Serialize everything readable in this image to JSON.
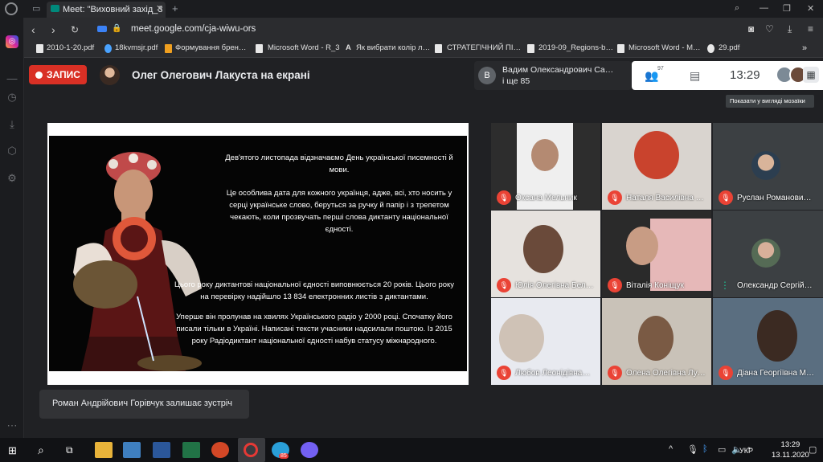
{
  "browser": {
    "tab_title": "Meet: \"Виховний захід_3 …",
    "url": "meet.google.com/cja-wiwu-ors",
    "bookmarks": [
      "2010-1-20.pdf",
      "18kvmsjr.pdf",
      "Формування брен…",
      "Microsoft Word - R_3",
      "Як вибрати колір л…",
      "СТРАТЕГІЧНИЙ ПІ…",
      "2019-09_Regions-b…",
      "Microsoft Word - M…",
      "29.pdf"
    ]
  },
  "meet": {
    "record_label": "ЗАПИС",
    "presenting": "Олег Олегович Лакуста на екрані",
    "participants_preview": "Вадим Олександрович Са…",
    "participants_more": "і ще 85",
    "participants_initial": "В",
    "participant_count": "97",
    "time": "13:29",
    "tooltip": "Показати у вигляді мозаїки",
    "toast": "Роман Андрійович Горівчук залишає зустріч",
    "tiles": [
      {
        "name": "Оксана Мельник"
      },
      {
        "name": "Наталя Василівна …"
      },
      {
        "name": "Руслан Романови…"
      },
      {
        "name": "Юлія Олегівна Бел…"
      },
      {
        "name": "Віталія Коніщук"
      },
      {
        "name": "Олександр Сергій…"
      },
      {
        "name": "Любов Леонідівна…"
      },
      {
        "name": "Олена Олегівна Лу…"
      },
      {
        "name": "Діана Георгіївна М…"
      }
    ]
  },
  "slide": {
    "p1": "Дев'ятого листопада відзначаємо День української писемності й мови.",
    "p2": "Це особлива дата для кожного українця, адже, всі, хто носить у серці українське слово, беруться за ручку й папір і з трепетом чекають, коли прозвучать перші слова диктанту національної єдності.",
    "p3": "Цього року диктантові національної єдності виповнюється 20 років. Цього року на перевірку надійшло 13 834 електронних листів з диктантами.",
    "p4": "Уперше він пролунав на хвилях Українського радіо у 2000 році. Спочатку його писали тільки в Україні. Написані тексти учасники надсилали поштою. Із 2015 року Радіодиктант національної єдності набув статусу міжнародного."
  },
  "taskbar": {
    "time": "13:29",
    "date": "13.11.2020",
    "lang": "УКР",
    "telegram_badge": "85"
  },
  "colors": {
    "record": "#d93025",
    "mic_off": "#ea4335",
    "meet_bg": "#202124"
  }
}
